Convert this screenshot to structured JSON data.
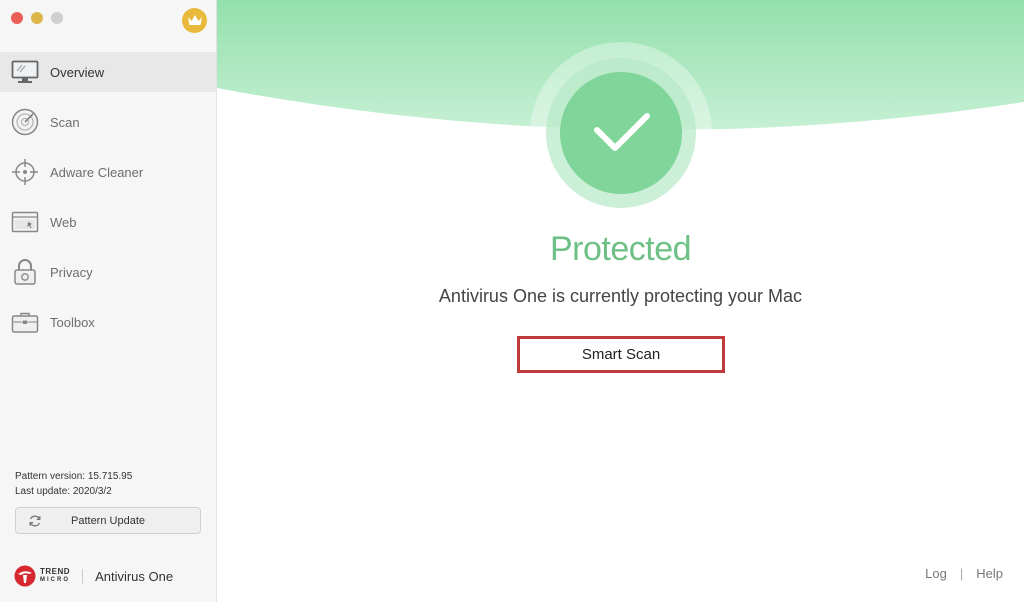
{
  "window": {
    "controls": [
      "close",
      "minimize",
      "zoom"
    ],
    "premium_icon": "crown-icon"
  },
  "sidebar": {
    "items": [
      {
        "label": "Overview",
        "icon": "monitor-icon",
        "active": true
      },
      {
        "label": "Scan",
        "icon": "radar-icon",
        "active": false
      },
      {
        "label": "Adware Cleaner",
        "icon": "crosshair-icon",
        "active": false
      },
      {
        "label": "Web",
        "icon": "browser-window-icon",
        "active": false
      },
      {
        "label": "Privacy",
        "icon": "padlock-icon",
        "active": false
      },
      {
        "label": "Toolbox",
        "icon": "toolbox-icon",
        "active": false
      }
    ],
    "pattern_version": "Pattern version: 15.715.95",
    "last_update": "Last update: 2020/3/2",
    "update_button": "Pattern Update",
    "brand": {
      "company_top": "TREND",
      "company_bottom": "MICRO",
      "product": "Antivirus One"
    }
  },
  "main": {
    "status_title": "Protected",
    "status_message": "Antivirus One is currently protecting your Mac",
    "scan_button": "Smart Scan",
    "footer": {
      "log": "Log",
      "help": "Help"
    }
  },
  "colors": {
    "accent_green": "#6fc086",
    "header_green": "#a8e6bc",
    "highlight_red": "#c0393b",
    "crown_gold": "#e8b93a"
  }
}
